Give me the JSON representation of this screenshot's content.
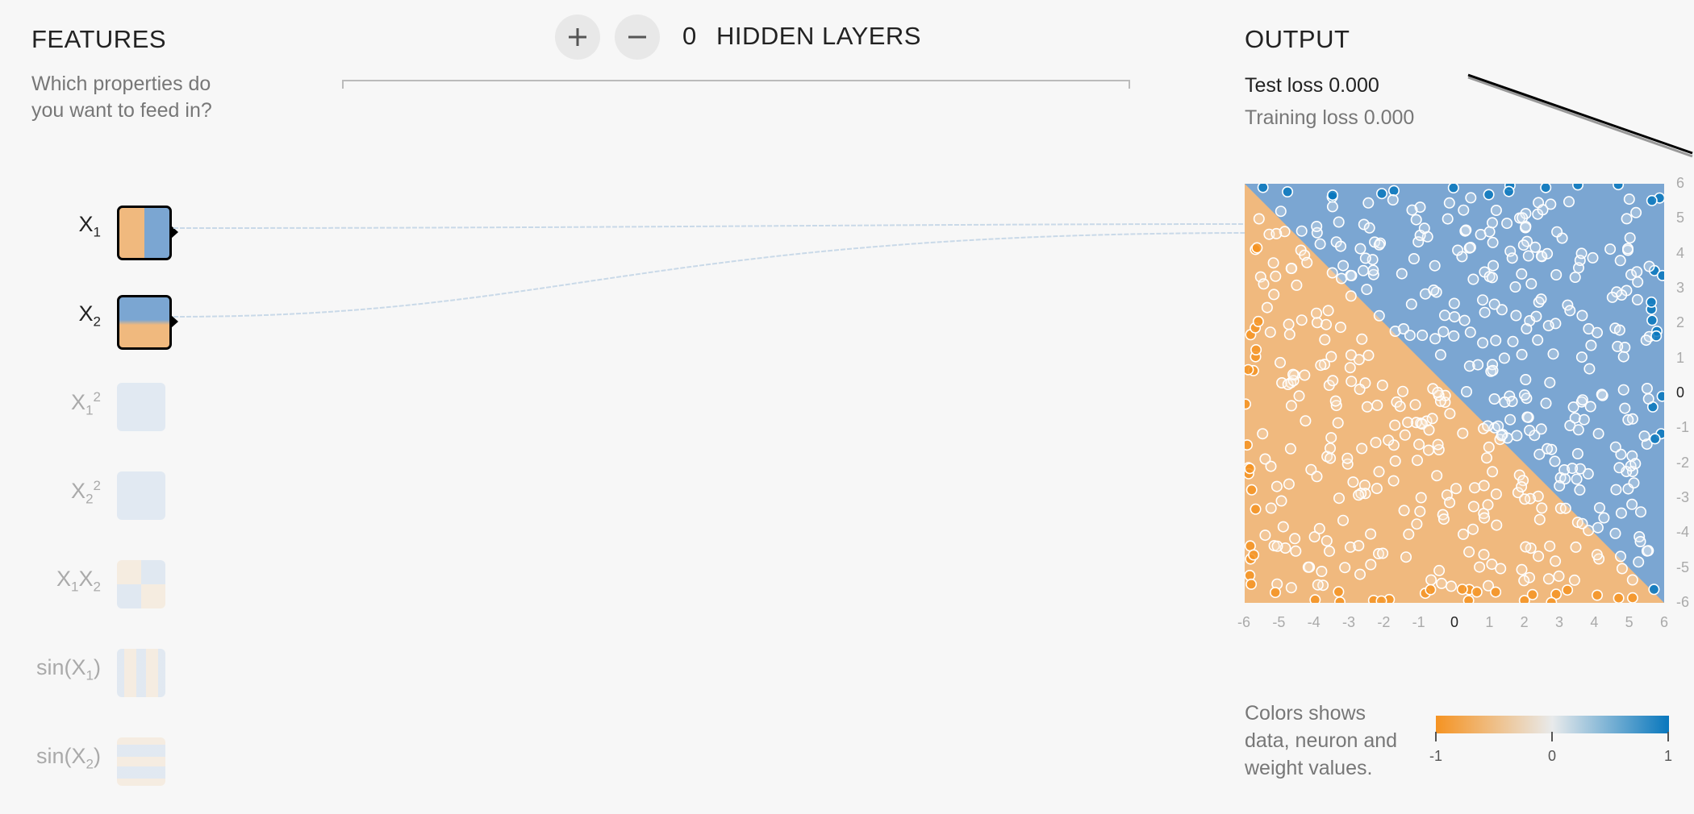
{
  "features": {
    "title": "FEATURES",
    "subtitle_line1": "Which properties do",
    "subtitle_line2": "you want to feed in?",
    "items": [
      {
        "label_html": "X<sub>1</sub>",
        "active": true,
        "icon": "x1-feature-thumbnail"
      },
      {
        "label_html": "X<sub>2</sub>",
        "active": true,
        "icon": "x2-feature-thumbnail"
      },
      {
        "label_html": "X<sub>1</sub><sup>2</sup>",
        "active": false,
        "icon": "x1-squared-thumbnail"
      },
      {
        "label_html": "X<sub>2</sub><sup>2</sup>",
        "active": false,
        "icon": "x2-squared-thumbnail"
      },
      {
        "label_html": "X<sub>1</sub>X<sub>2</sub>",
        "active": false,
        "icon": "x1x2-thumbnail"
      },
      {
        "label_html": "sin(X<sub>1</sub>)",
        "active": false,
        "icon": "sin-x1-thumbnail"
      },
      {
        "label_html": "sin(X<sub>2</sub>)",
        "active": false,
        "icon": "sin-x2-thumbnail"
      }
    ]
  },
  "layers": {
    "plus_icon": "plus-icon",
    "minus_icon": "minus-icon",
    "count": "0",
    "label": "HIDDEN LAYERS"
  },
  "output": {
    "title": "OUTPUT",
    "test_loss": "Test loss 0.000",
    "training_loss": "Training loss 0.000"
  },
  "legend": {
    "line1": "Colors shows",
    "line2": "data, neuron and",
    "line3": "weight values.",
    "min": "-1",
    "mid": "0",
    "max": "1"
  },
  "colors": {
    "orange": "#f59322",
    "blue": "#0877bd",
    "orange_bg": "#f0b97e",
    "blue_bg": "#7ba6d2",
    "background": "#f7f7f7"
  },
  "plot": {
    "x_ticks": [
      "-6",
      "-5",
      "-4",
      "-3",
      "-2",
      "-1",
      "0",
      "1",
      "2",
      "3",
      "4",
      "5",
      "6"
    ],
    "y_ticks": [
      "6",
      "5",
      "4",
      "3",
      "2",
      "1",
      "0",
      "-1",
      "-2",
      "-3",
      "-4",
      "-5",
      "-6"
    ],
    "xlim": [
      -6,
      6
    ],
    "ylim": [
      -6,
      6
    ],
    "decision_boundary": "x + y = 0"
  }
}
